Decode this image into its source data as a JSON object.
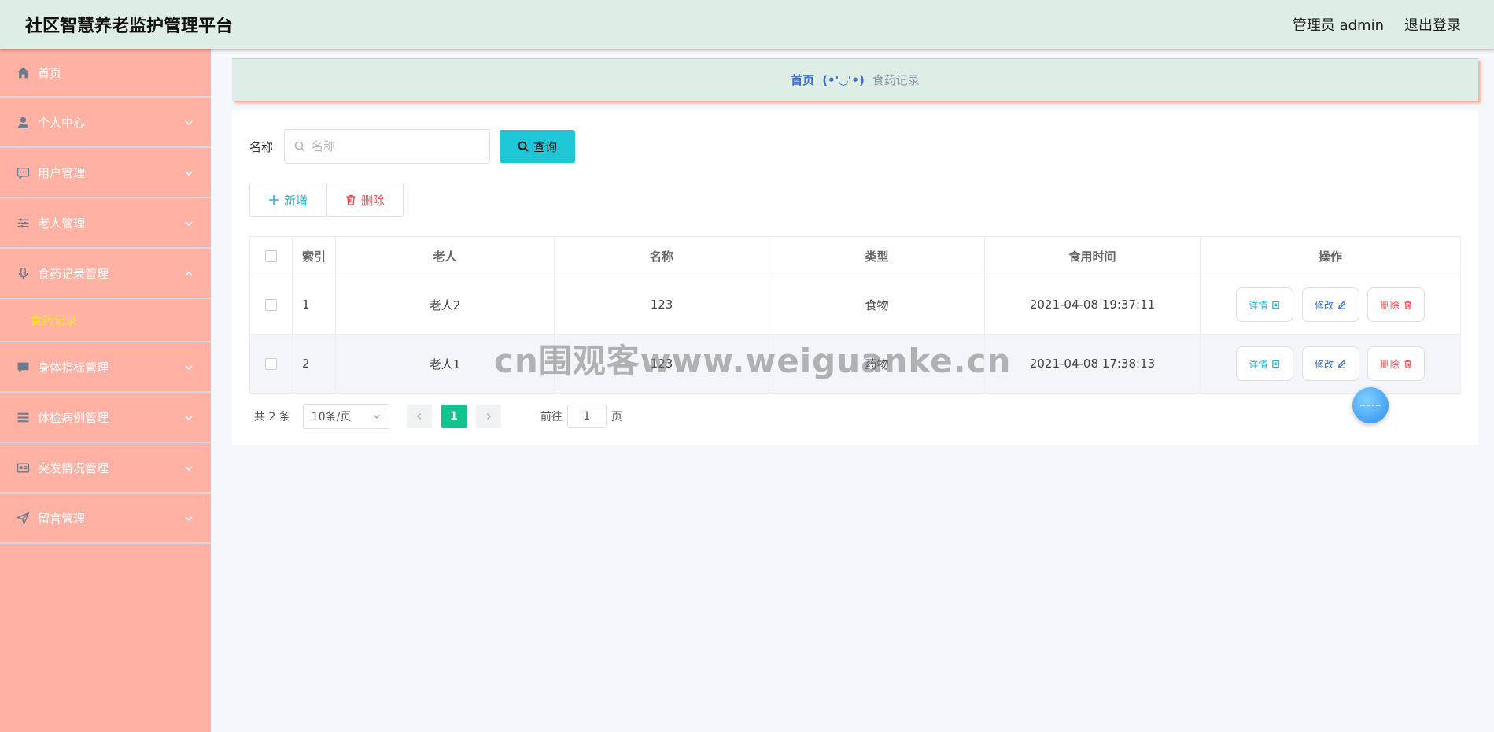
{
  "header": {
    "title": "社区智慧养老监护管理平台",
    "admin_label": "管理员 admin",
    "logout_label": "退出登录"
  },
  "sidebar": {
    "items": [
      {
        "label": "首页",
        "icon": "home-icon"
      },
      {
        "label": "个人中心",
        "icon": "user-icon"
      },
      {
        "label": "用户管理",
        "icon": "chat-icon"
      },
      {
        "label": "老人管理",
        "icon": "sliders-icon"
      },
      {
        "label": "食药记录管理",
        "icon": "microphone-icon"
      },
      {
        "label": "身体指标管理",
        "icon": "message-icon"
      },
      {
        "label": "体检病例管理",
        "icon": "list-icon"
      },
      {
        "label": "突发情况管理",
        "icon": "card-icon"
      },
      {
        "label": "留言管理",
        "icon": "send-icon"
      }
    ],
    "submenu_active": "食药记录"
  },
  "breadcrumb": {
    "home": "首页",
    "separator": "(•'◡'•)",
    "current": "食药记录"
  },
  "search": {
    "label": "名称",
    "placeholder": "名称",
    "query_button": "查询"
  },
  "actions": {
    "add_label": "新增",
    "delete_label": "删除"
  },
  "table": {
    "columns": [
      "索引",
      "老人",
      "名称",
      "类型",
      "食用时间",
      "操作"
    ],
    "rows": [
      {
        "index": "1",
        "elder": "老人2",
        "name": "123",
        "type": "食物",
        "time": "2021-04-08 19:37:11"
      },
      {
        "index": "2",
        "elder": "老人1",
        "name": "123",
        "type": "药物",
        "time": "2021-04-08 17:38:13"
      }
    ],
    "op_detail": "详情",
    "op_edit": "修改",
    "op_delete": "删除"
  },
  "pager": {
    "total": "共 2 条",
    "page_size": "10条/页",
    "current_page": "1",
    "goto_prefix": "前往",
    "goto_value": "1",
    "goto_suffix": "页"
  },
  "watermark": "cn围观客www.weiguanke.cn",
  "colors": {
    "sidebar_bg": "#ffb1a3",
    "header_bg": "#deeee7",
    "accent_cyan": "#1fc6d6",
    "page_active": "#12c28f",
    "danger": "#f0555a",
    "submenu_active": "#f5e52a"
  }
}
